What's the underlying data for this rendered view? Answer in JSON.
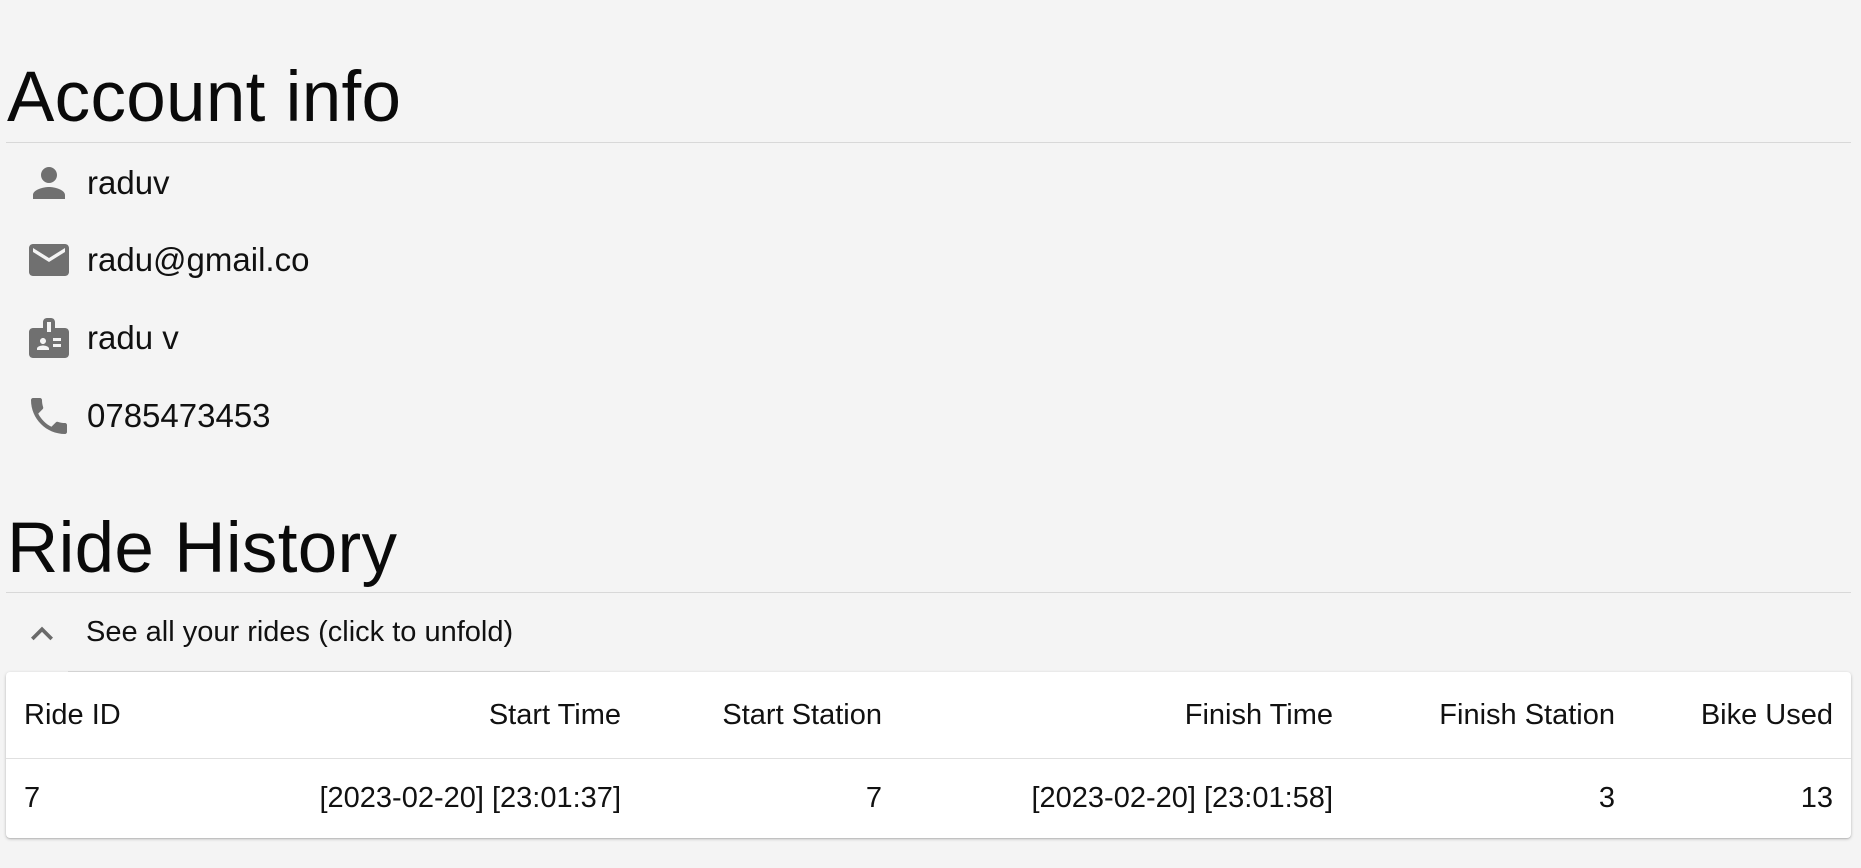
{
  "account": {
    "title": "Account info",
    "username": "raduv",
    "email": "radu@gmail.co",
    "full_name": "radu v",
    "phone": "0785473453"
  },
  "icons": {
    "username": "person-icon",
    "email": "mail-icon",
    "full_name": "badge-icon",
    "phone": "phone-icon",
    "accordion": "chevron-up-icon"
  },
  "ride_history": {
    "title": "Ride History",
    "accordion_label": "See all your rides (click to unfold)",
    "columns": [
      "Ride ID",
      "Start Time",
      "Start Station",
      "Finish Time",
      "Finish Station",
      "Bike Used"
    ],
    "rows": [
      [
        "7",
        "[2023-02-20] [23:01:37]",
        "7",
        "[2023-02-20] [23:01:58]",
        "3",
        "13"
      ]
    ]
  },
  "colors": {
    "background": "#f4f4f4",
    "icon": "#707070",
    "card": "#ffffff"
  }
}
